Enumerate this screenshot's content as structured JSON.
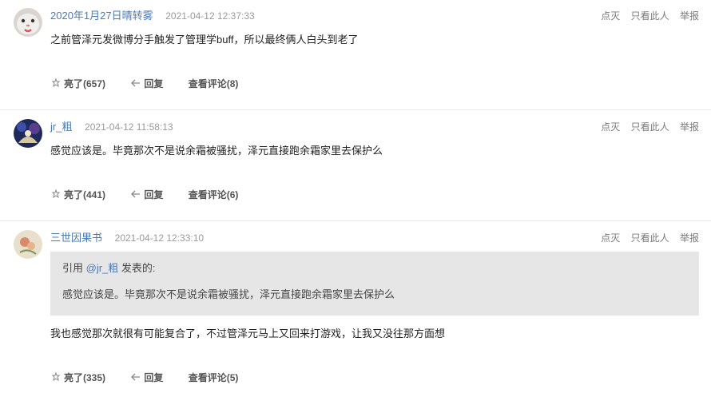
{
  "comments": [
    {
      "author": "2020年1月27日晴转雾",
      "time": "2021-04-12 12:37:33",
      "avatar_icon": "cat-avatar-icon",
      "actions": {
        "light_off": "点灭",
        "only_this": "只看此人",
        "report": "举报"
      },
      "text": "之前管泽元发微博分手触发了管理学buff，所以最终俩人白头到老了",
      "footer": {
        "like": "亮了(657)",
        "reply": "回复",
        "view_replies": "查看评论(8)"
      }
    },
    {
      "author": "jr_粗",
      "time": "2021-04-12 11:58:13",
      "avatar_icon": "anime-avatar-icon",
      "actions": {
        "light_off": "点灭",
        "only_this": "只看此人",
        "report": "举报"
      },
      "text": "感觉应该是。毕竟那次不是说余霜被骚扰，泽元直接跑余霜家里去保护么",
      "footer": {
        "like": "亮了(441)",
        "reply": "回复",
        "view_replies": "查看评论(6)"
      }
    },
    {
      "author": "三世因果书",
      "time": "2021-04-12 12:33:10",
      "avatar_icon": "flower-avatar-icon",
      "actions": {
        "light_off": "点灭",
        "only_this": "只看此人",
        "report": "举报"
      },
      "quote": {
        "prefix": "引用 ",
        "user": "@jr_粗",
        "suffix": " 发表的:",
        "text": "感觉应该是。毕竟那次不是说余霜被骚扰，泽元直接跑余霜家里去保护么"
      },
      "text": "我也感觉那次就很有可能复合了，不过管泽元马上又回来打游戏，让我又没往那方面想",
      "footer": {
        "like": "亮了(335)",
        "reply": "回复",
        "view_replies": "查看评论(5)"
      }
    }
  ],
  "colors": {
    "link": "#4c7ab5",
    "quote_bg": "#e6e6e6",
    "divider": "#e8e8e8"
  }
}
